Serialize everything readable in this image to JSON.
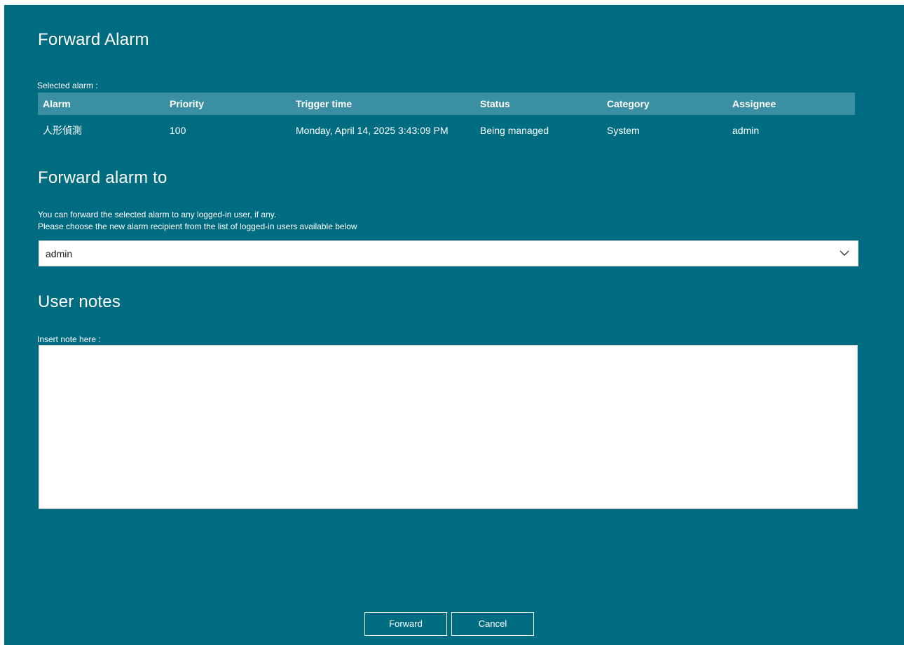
{
  "dialog": {
    "title": "Forward Alarm"
  },
  "selected_alarm": {
    "label": "Selected alarm :",
    "columns": [
      "Alarm",
      "Priority",
      "Trigger time",
      "Status",
      "Category",
      "Assignee"
    ],
    "row": [
      "人形偵測",
      "100",
      "Monday, April 14, 2025 3:43:09 PM",
      "Being managed",
      "System",
      "admin"
    ]
  },
  "forward_to": {
    "heading": "Forward alarm to",
    "description_line1": "You can forward the selected alarm to any logged-in user, if any.",
    "description_line2": "Please choose the new alarm recipient from the list of logged-in users available below",
    "selected_user": "admin",
    "dropdown_icon": "chevron-down-icon"
  },
  "user_notes": {
    "heading": "User notes",
    "label": "Insert note here :",
    "value": ""
  },
  "buttons": {
    "forward": "Forward",
    "cancel": "Cancel"
  },
  "colors": {
    "background": "#006c81",
    "table_header": "#3a8fa2",
    "text": "#ffffff"
  }
}
